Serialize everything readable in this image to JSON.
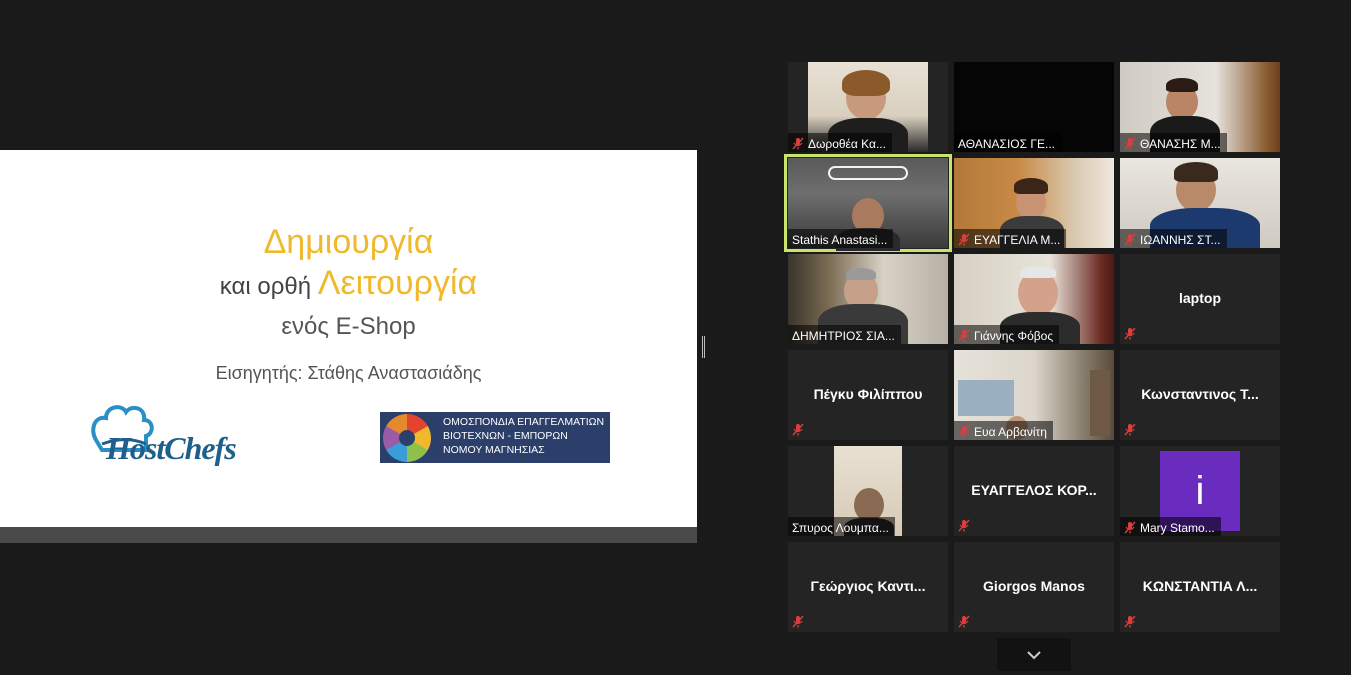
{
  "slide": {
    "line1": "Δημιουργία",
    "line2_prefix": "και ορθή ",
    "line2_accent": "Λειτουργία",
    "line3": "ενός E-Shop",
    "presenter": "Εισηγητής: Στάθης Αναστασιάδης",
    "logo_left": "HostChefs",
    "org_lines": [
      "ΟΜΟΣΠΟΝΔΙΑ ΕΠΑΓΓΕΛΜΑΤΙΩΝ",
      "ΒΙΟΤΕΧΝΩΝ - ΕΜΠΟΡΩΝ",
      "ΝΟΜΟΥ ΜΑΓΝΗΣΙΑΣ"
    ],
    "accent_color": "#f0b92d"
  },
  "gallery": {
    "participants": [
      {
        "name": "Δωροθέα Κα...",
        "video": true,
        "muted": true
      },
      {
        "name": "ΑΘΑΝΑΣΙΟΣ ΓΕ...",
        "video": true,
        "muted": false
      },
      {
        "name": "ΘΑΝΑΣΗΣ Μ...",
        "video": true,
        "muted": true
      },
      {
        "name": "Stathis Anastasi...",
        "video": true,
        "muted": false,
        "active_speaker": true
      },
      {
        "name": "ΕΥΑΓΓΕΛΙΑ Μ...",
        "video": true,
        "muted": true
      },
      {
        "name": "ΙΩΑΝΝΗΣ ΣΤ...",
        "video": true,
        "muted": true
      },
      {
        "name": "ΔΗΜΗΤΡΙΟΣ ΣΙΑ...",
        "video": true,
        "muted": false
      },
      {
        "name": "Γιάννης Φόβος",
        "video": true,
        "muted": true
      },
      {
        "name": "laptop",
        "video": false,
        "muted": true
      },
      {
        "name": "Πέγκυ Φιλίππου",
        "video": false,
        "muted": true
      },
      {
        "name": "Ευα Αρβανίτη",
        "video": true,
        "muted": true
      },
      {
        "name": "Κωνσταντινος Τ...",
        "video": false,
        "muted": true
      },
      {
        "name": "Σπυρος Λουμπα...",
        "video": true,
        "muted": false
      },
      {
        "name": "ΕΥΑΓΓΕΛΟΣ ΚΟΡ...",
        "video": false,
        "muted": true
      },
      {
        "name": "Mary Stamo...",
        "video": false,
        "muted": true,
        "avatar_letter": "i",
        "avatar_color": "#6a2bbf"
      },
      {
        "name": "Γεώργιος Καντι...",
        "video": false,
        "muted": true
      },
      {
        "name": "Giorgos Manos",
        "video": false,
        "muted": true
      },
      {
        "name": "ΚΩΝΣΤΑΝΤΙΑ Λ...",
        "video": false,
        "muted": true
      }
    ]
  },
  "icons": {
    "muted_mic": "muted-mic-icon",
    "scroll_down": "chevron-down-icon"
  },
  "colors": {
    "active_speaker_border": "#c9e36b",
    "muted_mic": "#e03c3c",
    "tile_bg": "#242424"
  }
}
